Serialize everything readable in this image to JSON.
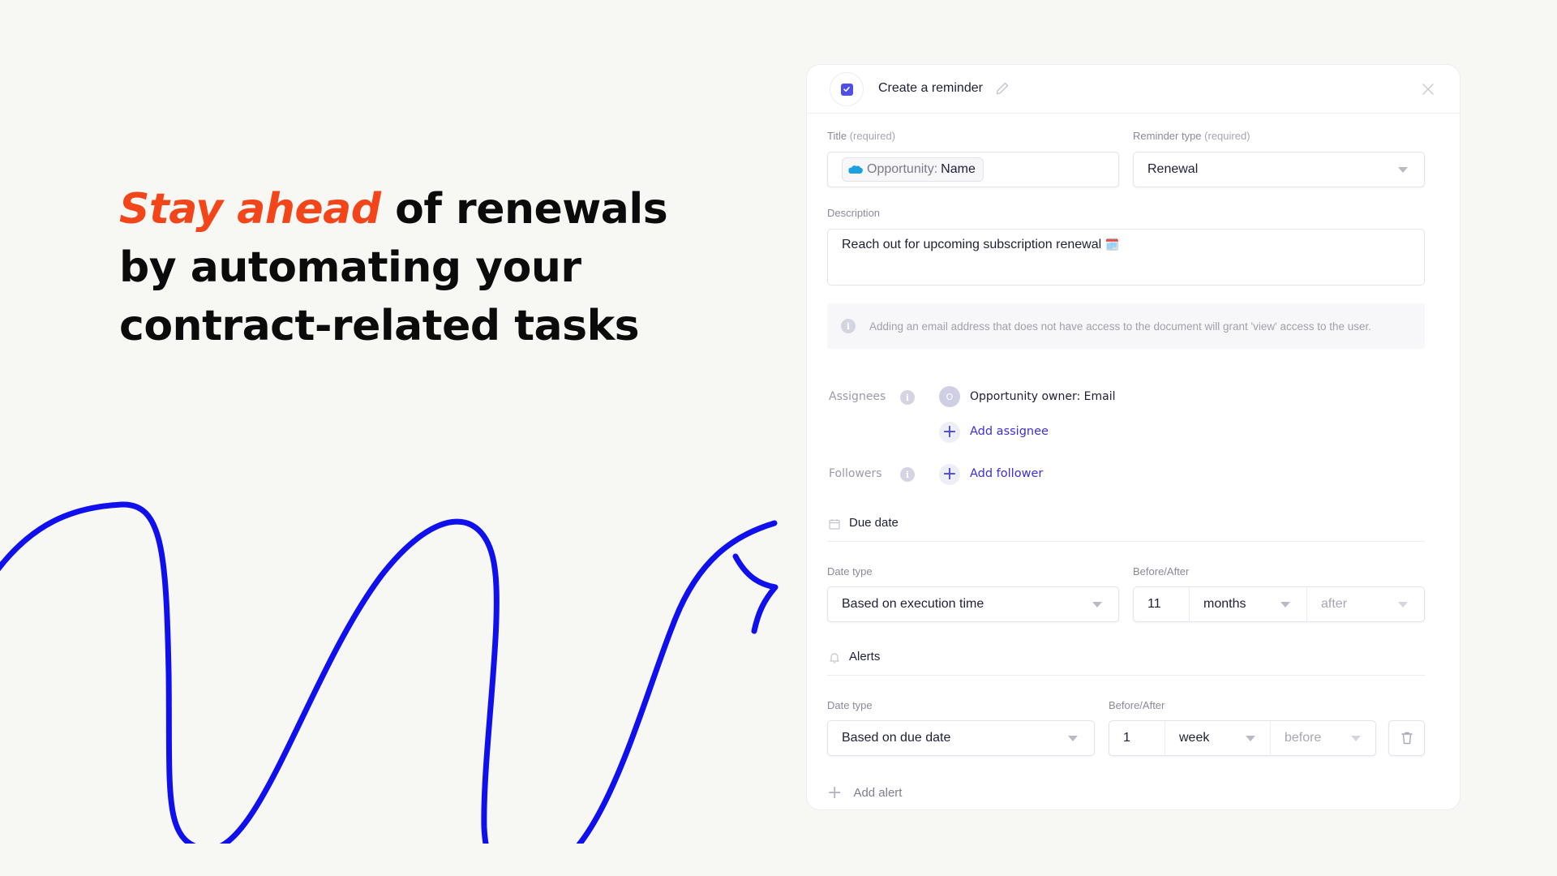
{
  "headline": {
    "accent": "Stay ahead",
    "rest": " of renewals by automating your contract-related tasks",
    "accent_color": "#f2461a"
  },
  "decor": {
    "arrow_color": "#1010ee"
  },
  "reminder": {
    "title": "Create a reminder",
    "icons": {
      "check": "checkbox-checked-icon",
      "edit": "pencil-icon",
      "close": "close-icon"
    },
    "title_field": {
      "label": "Title",
      "label_hint": "(required)",
      "chip_icon": "salesforce-cloud-icon",
      "chip_prefix": "Opportunity:",
      "chip_value": "Name"
    },
    "reminder_type": {
      "label": "Reminder type",
      "label_hint": "(required)",
      "value": "Renewal"
    },
    "description": {
      "label": "Description",
      "value": "Reach out for upcoming subscription renewal",
      "emoji": "🗓️"
    },
    "info_note": "Adding an email address that does not have access to the document will grant 'view' access to the user.",
    "assignees": {
      "label": "Assignees",
      "items": [
        {
          "avatar_initial": "O",
          "name": "Opportunity owner: Email"
        }
      ],
      "add_label": "Add assignee"
    },
    "followers": {
      "label": "Followers",
      "add_label": "Add follower"
    },
    "due_date": {
      "section_title": "Due date",
      "date_type_label": "Date type",
      "date_type_value": "Based on execution time",
      "before_after_label": "Before/After",
      "amount": "11",
      "unit": "months",
      "direction": "after"
    },
    "alerts": {
      "section_title": "Alerts",
      "items": [
        {
          "date_type_label": "Date type",
          "date_type_value": "Based on due date",
          "before_after_label": "Before/After",
          "amount": "1",
          "unit": "week",
          "direction": "before"
        }
      ],
      "add_label": "Add alert"
    },
    "colors": {
      "primary": "#4f4ee6",
      "link": "#3c2fd6",
      "text": "#1e1f36",
      "muted": "#8a8a98"
    }
  }
}
